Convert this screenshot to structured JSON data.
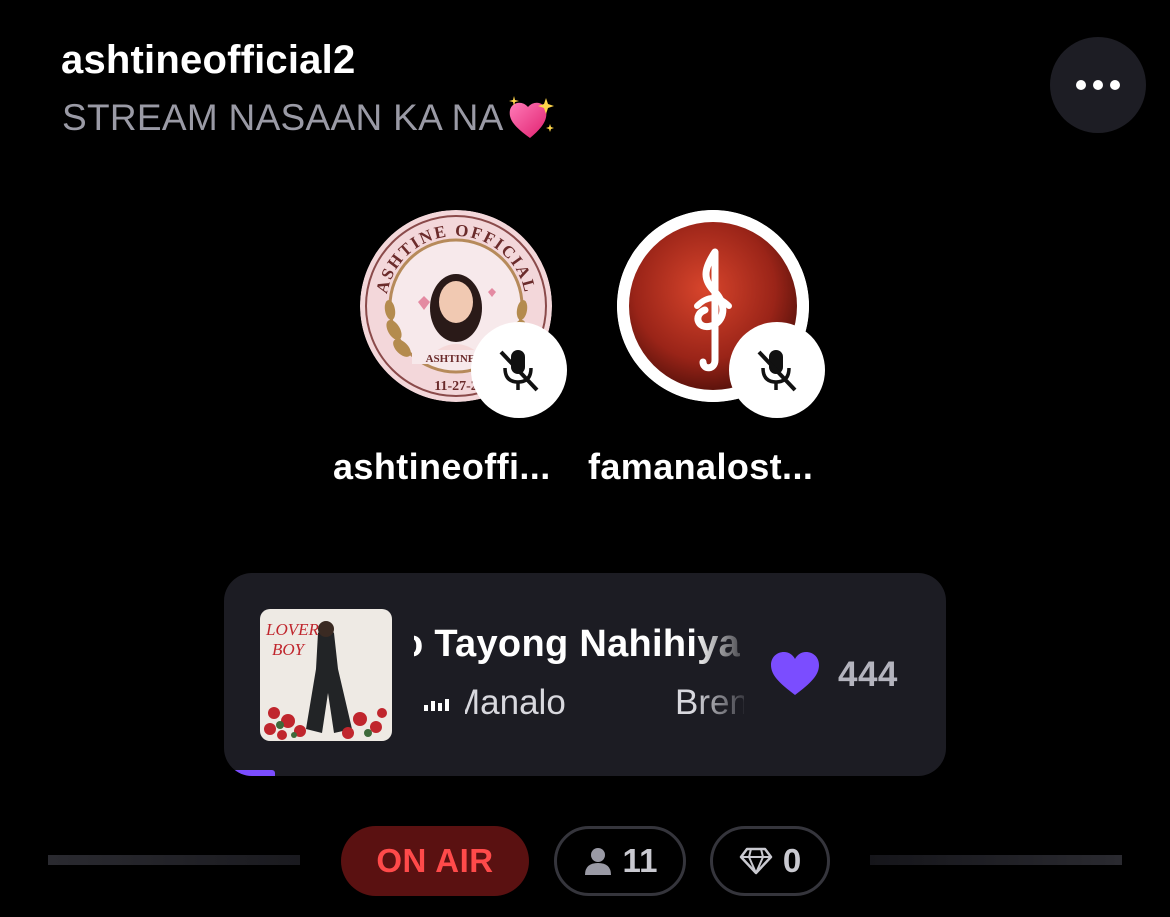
{
  "room": {
    "title": "ashtineofficial2",
    "subtitle": "STREAM NASAAN KA NA",
    "subtitle_emoji": "sparkling-heart"
  },
  "header": {
    "more_icon": "more-horizontal-icon"
  },
  "speakers": [
    {
      "name": "ashtineoffi...",
      "avatar_ring_text": "ASHTINE OFFICIAL",
      "avatar_lower_text": "ASHTINE O",
      "avatar_date": "11-27-2",
      "muted": true
    },
    {
      "name": "famanalost...",
      "avatar_icon": "treble-clef-icon",
      "muted": true
    }
  ],
  "now_playing": {
    "title": "o Tayong Nahihiya",
    "artists": [
      "Manalo",
      "Brent"
    ],
    "album_art_text_1": "LOVER",
    "album_art_text_2": "BOY",
    "likes": "444",
    "accent_color": "#7b4dff",
    "progress": 0.07
  },
  "status": {
    "on_air_label": "ON AIR",
    "listeners": "11",
    "gifts": "0",
    "on_air_color": "#ff4a4a"
  }
}
